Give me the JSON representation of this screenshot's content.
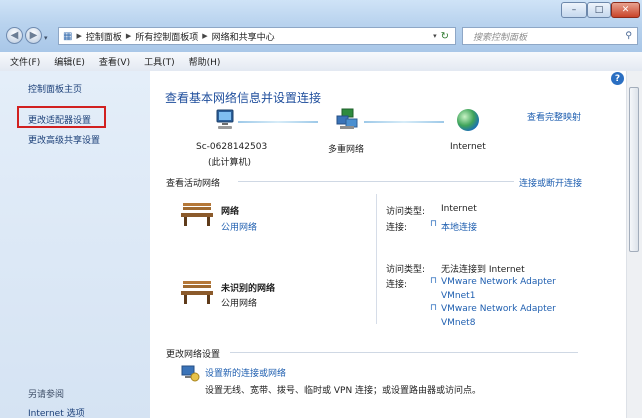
{
  "window": {
    "minimize": "–",
    "maximize": "□",
    "close": "✕"
  },
  "address": {
    "segments": [
      "控制面板",
      "所有控制面板项",
      "网络和共享中心"
    ],
    "search_placeholder": "搜索控制面板"
  },
  "menu": [
    "文件(F)",
    "编辑(E)",
    "查看(V)",
    "工具(T)",
    "帮助(H)"
  ],
  "sidebar": {
    "items": [
      "控制面板主页",
      "更改适配器设置",
      "更改高级共享设置"
    ],
    "see_also_title": "另请参阅",
    "see_also_items": [
      "Internet 选项"
    ]
  },
  "main": {
    "title": "查看基本网络信息并设置连接",
    "full_map": "查看完整映射",
    "map": {
      "computer_name": "Sc-0628142503",
      "computer_sub": "(此计算机)",
      "middle": "多重网络",
      "right": "Internet"
    },
    "active_title": "查看活动网络",
    "connect_link": "连接或断开连接",
    "networks": [
      {
        "name": "网络",
        "type": "公用网络",
        "access_label": "访问类型:",
        "access_value": "Internet",
        "conn_label": "连接:",
        "conns": [
          "本地连接"
        ]
      },
      {
        "name": "未识别的网络",
        "type": "公用网络",
        "access_label": "访问类型:",
        "access_value": "无法连接到 Internet",
        "conn_label": "连接:",
        "conns": [
          "VMware Network Adapter",
          "VMnet1",
          "VMware Network Adapter",
          "VMnet8"
        ]
      }
    ],
    "change_title": "更改网络设置",
    "setup_link": "设置新的连接或网络",
    "setup_desc": "设置无线、宽带、拨号、临时或 VPN 连接；或设置路由器或访问点。"
  },
  "help_icon": "?",
  "colors": {
    "accent_link": "#1f5fb0",
    "title_blue": "#1f4e9c",
    "highlight_red": "#d12020"
  }
}
